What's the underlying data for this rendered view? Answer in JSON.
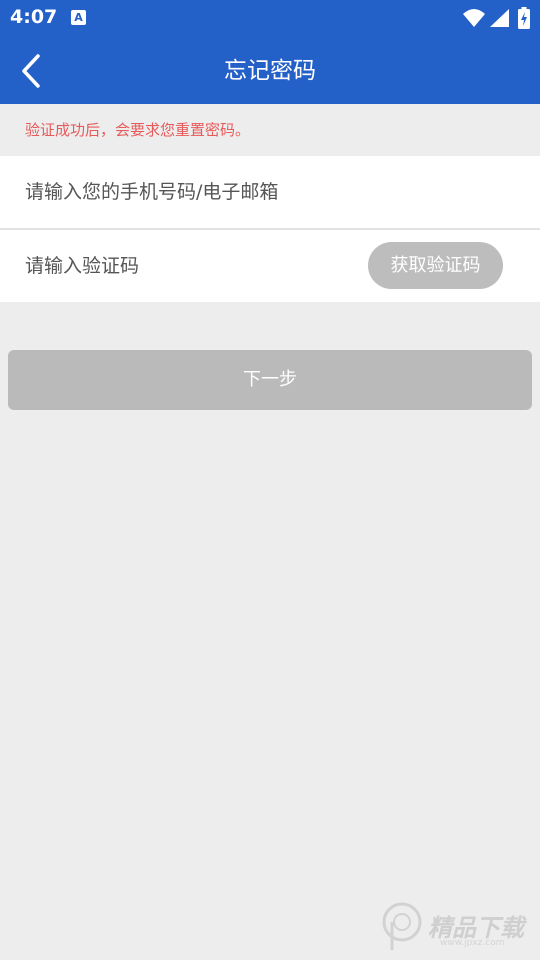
{
  "status_bar": {
    "time": "4:07",
    "notification_icon": "A"
  },
  "header": {
    "title": "忘记密码",
    "back_icon": "chevron-left-icon"
  },
  "hint": {
    "text": "验证成功后，会要求您重置密码。"
  },
  "form": {
    "account_placeholder": "请输入您的手机号码/电子邮箱",
    "account_value": "",
    "code_placeholder": "请输入验证码",
    "code_value": "",
    "get_code_label": "获取验证码"
  },
  "actions": {
    "next_label": "下一步"
  },
  "watermark": {
    "text": "精品下载",
    "url": "www.jpxz.com"
  },
  "colors": {
    "header_bg": "#2360c8",
    "hint_text": "#e85a5a",
    "page_bg": "#ededed",
    "button_disabled": "#bababa"
  }
}
